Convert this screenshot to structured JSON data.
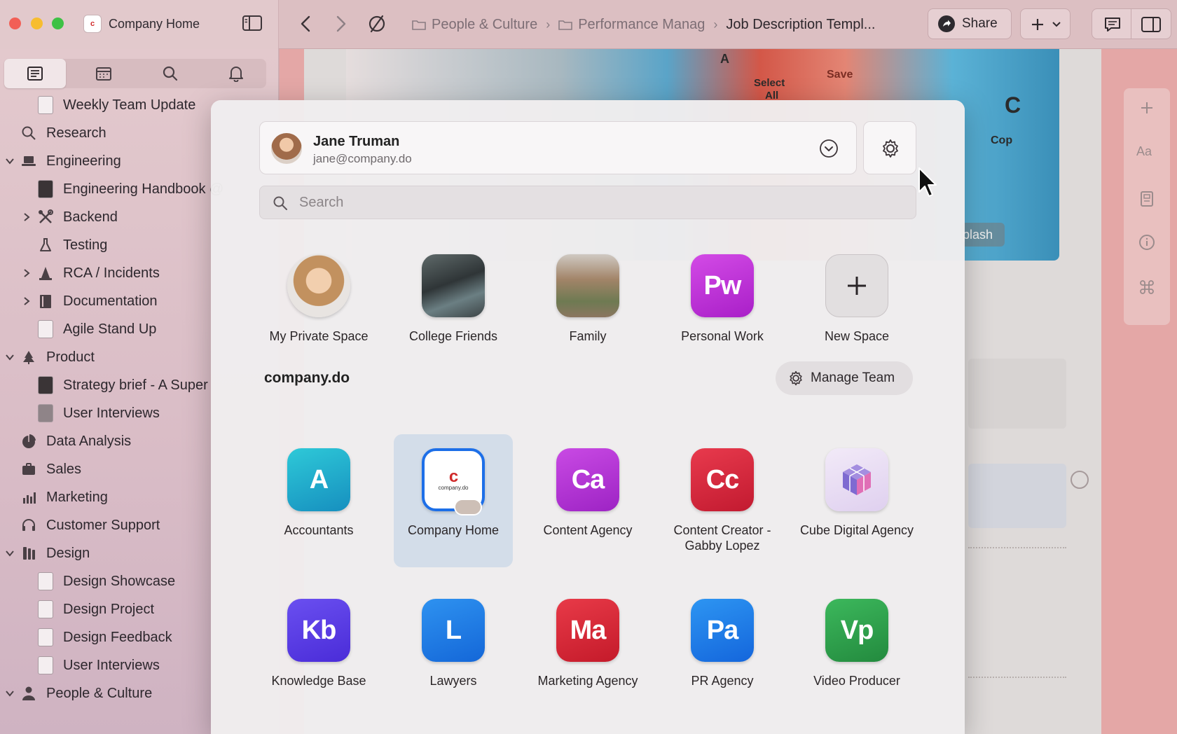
{
  "window": {
    "workspace_title": "Company Home",
    "workspace_logo_text": "c"
  },
  "breadcrumb": {
    "items": [
      "People & Culture",
      "Performance Manag"
    ],
    "current": "Job Description Templ..."
  },
  "toolbar": {
    "share_label": "Share"
  },
  "sidebar": {
    "items": [
      {
        "label": "Weekly Team Update",
        "icon": "doc-thumb"
      },
      {
        "label": "Research",
        "icon": "search-icon"
      },
      {
        "label": "Engineering",
        "icon": "laptop-icon"
      },
      {
        "label": "Engineering Handbook @",
        "icon": "doc-thumb"
      },
      {
        "label": "Backend",
        "icon": "tools-icon"
      },
      {
        "label": "Testing",
        "icon": "flask-icon"
      },
      {
        "label": "RCA / Incidents",
        "icon": "cone-icon"
      },
      {
        "label": "Documentation",
        "icon": "book-icon"
      },
      {
        "label": "Agile Stand Up",
        "icon": "doc-thumb"
      },
      {
        "label": "Product",
        "icon": "tree-icon"
      },
      {
        "label": "Strategy brief - A Super",
        "icon": "doc-thumb"
      },
      {
        "label": "User Interviews",
        "icon": "doc-thumb"
      },
      {
        "label": "Data Analysis",
        "icon": "pie-chart-icon"
      },
      {
        "label": "Sales",
        "icon": "briefcase-icon"
      },
      {
        "label": "Marketing",
        "icon": "bar-chart-icon"
      },
      {
        "label": "Customer Support",
        "icon": "headset-icon"
      },
      {
        "label": "Design",
        "icon": "swatch-icon"
      },
      {
        "label": "Design Showcase",
        "icon": "doc-thumb"
      },
      {
        "label": "Design Project",
        "icon": "doc-thumb"
      },
      {
        "label": "Design Feedback",
        "icon": "doc-thumb"
      },
      {
        "label": "User Interviews",
        "icon": "doc-thumb"
      },
      {
        "label": "People & Culture",
        "icon": "person-icon"
      }
    ]
  },
  "cover": {
    "key_select": "Select",
    "key_all": "All",
    "key_save": "Save",
    "key_a": "A",
    "key_cut": "C",
    "key_copy": "Cop",
    "attribution": "plash"
  },
  "rail": {
    "font_label": "Aa"
  },
  "switcher": {
    "account": {
      "name": "Jane Truman",
      "email": "jane@company.do"
    },
    "search_placeholder": "Search",
    "personal_spaces": [
      {
        "label": "My Private Space",
        "kind": "photo"
      },
      {
        "label": "College Friends",
        "kind": "photo"
      },
      {
        "label": "Family",
        "kind": "photo"
      },
      {
        "label": "Personal Work",
        "initials": "Pw",
        "color": "#c735d9"
      },
      {
        "label": "New Space",
        "kind": "add"
      }
    ],
    "team_name": "company.do",
    "manage_team_label": "Manage Team",
    "team_spaces": [
      {
        "label": "Accountants",
        "initials": "A",
        "color": "#1fa9c7"
      },
      {
        "label": "Company Home",
        "logo_text": "c",
        "logo_sub": "company.do",
        "selected": true
      },
      {
        "label": "Content Agency",
        "initials": "Ca",
        "color": "#b934d4"
      },
      {
        "label": "Content Creator - Gabby Lopez",
        "initials": "Cc",
        "color": "#d8283f"
      },
      {
        "label": "Cube Digital Agency",
        "kind": "cube"
      },
      {
        "label": "Knowledge Base",
        "initials": "Kb",
        "color": "#5b3de6"
      },
      {
        "label": "Lawyers",
        "initials": "L",
        "color": "#1f7ee6"
      },
      {
        "label": "Marketing Agency",
        "initials": "Ma",
        "color": "#d92a3a"
      },
      {
        "label": "PR Agency",
        "initials": "Pa",
        "color": "#1e80e8"
      },
      {
        "label": "Video Producer",
        "initials": "Vp",
        "color": "#2fa44c"
      }
    ]
  }
}
